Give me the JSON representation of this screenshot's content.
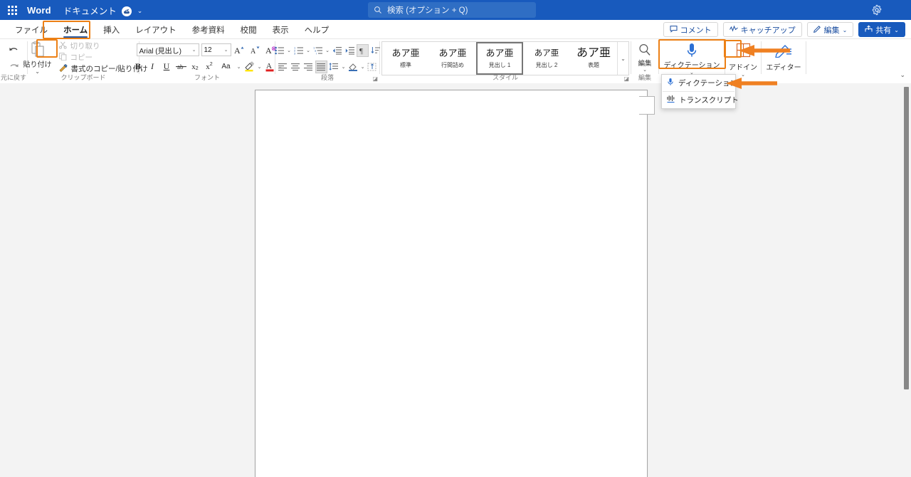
{
  "titlebar": {
    "waffle_icon": "app-launcher-icon",
    "app_name": "Word",
    "doc_title": "ドキュメント",
    "autosave_icon": "autosave-cloud-icon",
    "title_chevron": "⌄",
    "settings_icon": "gear-icon"
  },
  "search": {
    "icon": "search-icon",
    "placeholder": "検索 (オプション + Q)"
  },
  "tabs": [
    {
      "label": "ファイル",
      "active": false
    },
    {
      "label": "ホーム",
      "active": true
    },
    {
      "label": "挿入",
      "active": false
    },
    {
      "label": "レイアウト",
      "active": false
    },
    {
      "label": "参考資料",
      "active": false
    },
    {
      "label": "校閲",
      "active": false
    },
    {
      "label": "表示",
      "active": false
    },
    {
      "label": "ヘルプ",
      "active": false
    }
  ],
  "right_actions": {
    "comment": "コメント",
    "comment_icon": "comment-icon",
    "catchup": "キャッチアップ",
    "catchup_icon": "activity-icon",
    "edit": "編集",
    "edit_icon": "pencil-icon",
    "edit_chevron": "⌄",
    "share": "共有",
    "share_icon": "share-icon",
    "share_chevron": "⌄"
  },
  "ribbon": {
    "undo": {
      "group_label": "元に戻す",
      "undo_icon": "undo-arrow-icon",
      "redo_icon": "redo-arrow-icon"
    },
    "clipboard": {
      "group_label": "クリップボード",
      "paste_label": "貼り付け",
      "paste_icon": "clipboard-paste-icon",
      "paste_chevron": "⌄",
      "cut_label": "切り取り",
      "cut_icon": "scissors-icon",
      "copy_label": "コピー",
      "copy_icon": "copy-icon",
      "format_painter_label": "書式のコピー/貼り付け",
      "format_painter_icon": "format-painter-icon"
    },
    "font": {
      "group_label": "フォント",
      "font_name": "Arial (見出し)",
      "font_size": "12",
      "grow_font_icon": "grow-font-icon",
      "shrink_font_icon": "shrink-font-icon",
      "clear_format_icon": "clear-formatting-icon",
      "bold_icon": "bold-icon",
      "bold_label": "B",
      "italic_icon": "italic-icon",
      "italic_label": "I",
      "underline_icon": "underline-icon",
      "underline_label": "U",
      "strike_icon": "strikethrough-icon",
      "subscript_icon": "subscript-icon",
      "superscript_icon": "superscript-icon",
      "change_case_icon": "change-case-icon",
      "change_case_label": "Aa",
      "highlight_icon": "text-highlight-icon",
      "font_color_icon": "font-color-icon",
      "chevron": "⌄"
    },
    "paragraph": {
      "group_label": "段落",
      "bullets_icon": "bullet-list-icon",
      "numbering_icon": "numbered-list-icon",
      "multilevel_icon": "multilevel-list-icon",
      "decrease_indent_icon": "decrease-indent-icon",
      "increase_indent_icon": "increase-indent-icon",
      "sort_icon": "sort-icon",
      "show_marks_icon": "show-paragraph-marks-icon",
      "align_left_icon": "align-left-icon",
      "align_center_icon": "align-center-icon",
      "align_right_icon": "align-right-icon",
      "justify_icon": "justify-icon",
      "line_spacing_icon": "line-spacing-icon",
      "shading_icon": "shading-icon",
      "borders_icon": "borders-icon",
      "dialog_launcher_icon": "dialog-launcher-icon",
      "chevron": "⌄"
    },
    "styles": {
      "group_label": "スタイル",
      "dialog_launcher_icon": "dialog-launcher-icon",
      "more_icon": "chevron-down-icon",
      "items": [
        {
          "sample": "あア亜",
          "name": "標準",
          "selected": false,
          "size": "normal",
          "bold": false
        },
        {
          "sample": "あア亜",
          "name": "行間詰め",
          "selected": false,
          "size": "normal",
          "bold": false
        },
        {
          "sample": "あア亜",
          "name": "見出し 1",
          "selected": true,
          "size": "normal",
          "bold": false
        },
        {
          "sample": "あア亜",
          "name": "見出し 2",
          "selected": false,
          "size": "small",
          "bold": false
        },
        {
          "sample": "あア亜",
          "name": "表題",
          "selected": false,
          "size": "big",
          "bold": false
        }
      ]
    },
    "editing": {
      "group_label": "編集",
      "button_label": "編集",
      "icon": "search-magnifier-icon",
      "chevron": "⌄"
    },
    "dictation": {
      "button_label": "ディクテーション",
      "icon": "microphone-icon",
      "chevron": "⌄"
    },
    "addins": {
      "button_label": "アドイン",
      "icon": "addins-grid-icon",
      "chevron": "⌄"
    },
    "editor": {
      "button_label": "エディター",
      "icon": "editor-pen-icon"
    },
    "collapse_icon": "chevron-up-icon"
  },
  "dropdown": {
    "items": [
      {
        "label": "ディクテーション",
        "icon": "microphone-icon"
      },
      {
        "label": "トランスクリプト",
        "icon": "transcript-icon"
      }
    ]
  },
  "document": {
    "page_handle_icon": "page-edge-handle"
  },
  "scrollbar": {
    "thumb_icon": "vertical-scroll-thumb"
  },
  "annotations": {
    "highlight_color": "#ec8016",
    "arrow_color": "#ef8022",
    "targets": [
      "home-tab",
      "paste-button",
      "dictation-button",
      "addins-button",
      "dropdown-dictation-item"
    ]
  },
  "colors": {
    "titlebar": "#185abd",
    "accent": "#2b579a",
    "share_button": "#185abd",
    "ribbon_bg": "#ffffff",
    "canvas_bg": "#f3f3f3",
    "highlight": "#ec8016"
  }
}
